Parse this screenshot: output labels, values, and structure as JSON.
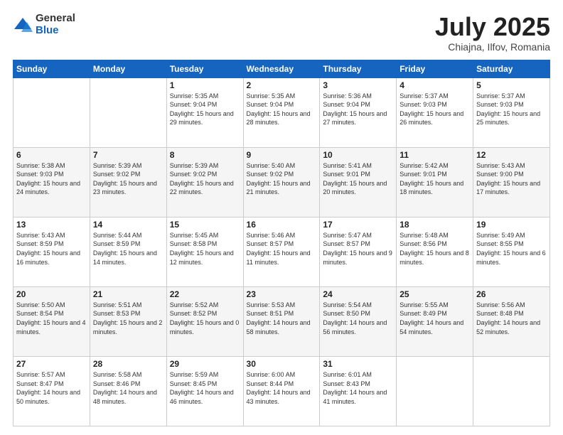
{
  "logo": {
    "general": "General",
    "blue": "Blue"
  },
  "title": "July 2025",
  "location": "Chiajna, Ilfov, Romania",
  "days_of_week": [
    "Sunday",
    "Monday",
    "Tuesday",
    "Wednesday",
    "Thursday",
    "Friday",
    "Saturday"
  ],
  "weeks": [
    [
      {
        "day": "",
        "content": ""
      },
      {
        "day": "",
        "content": ""
      },
      {
        "day": "1",
        "content": "Sunrise: 5:35 AM\nSunset: 9:04 PM\nDaylight: 15 hours and 29 minutes."
      },
      {
        "day": "2",
        "content": "Sunrise: 5:35 AM\nSunset: 9:04 PM\nDaylight: 15 hours and 28 minutes."
      },
      {
        "day": "3",
        "content": "Sunrise: 5:36 AM\nSunset: 9:04 PM\nDaylight: 15 hours and 27 minutes."
      },
      {
        "day": "4",
        "content": "Sunrise: 5:37 AM\nSunset: 9:03 PM\nDaylight: 15 hours and 26 minutes."
      },
      {
        "day": "5",
        "content": "Sunrise: 5:37 AM\nSunset: 9:03 PM\nDaylight: 15 hours and 25 minutes."
      }
    ],
    [
      {
        "day": "6",
        "content": "Sunrise: 5:38 AM\nSunset: 9:03 PM\nDaylight: 15 hours and 24 minutes."
      },
      {
        "day": "7",
        "content": "Sunrise: 5:39 AM\nSunset: 9:02 PM\nDaylight: 15 hours and 23 minutes."
      },
      {
        "day": "8",
        "content": "Sunrise: 5:39 AM\nSunset: 9:02 PM\nDaylight: 15 hours and 22 minutes."
      },
      {
        "day": "9",
        "content": "Sunrise: 5:40 AM\nSunset: 9:02 PM\nDaylight: 15 hours and 21 minutes."
      },
      {
        "day": "10",
        "content": "Sunrise: 5:41 AM\nSunset: 9:01 PM\nDaylight: 15 hours and 20 minutes."
      },
      {
        "day": "11",
        "content": "Sunrise: 5:42 AM\nSunset: 9:01 PM\nDaylight: 15 hours and 18 minutes."
      },
      {
        "day": "12",
        "content": "Sunrise: 5:43 AM\nSunset: 9:00 PM\nDaylight: 15 hours and 17 minutes."
      }
    ],
    [
      {
        "day": "13",
        "content": "Sunrise: 5:43 AM\nSunset: 8:59 PM\nDaylight: 15 hours and 16 minutes."
      },
      {
        "day": "14",
        "content": "Sunrise: 5:44 AM\nSunset: 8:59 PM\nDaylight: 15 hours and 14 minutes."
      },
      {
        "day": "15",
        "content": "Sunrise: 5:45 AM\nSunset: 8:58 PM\nDaylight: 15 hours and 12 minutes."
      },
      {
        "day": "16",
        "content": "Sunrise: 5:46 AM\nSunset: 8:57 PM\nDaylight: 15 hours and 11 minutes."
      },
      {
        "day": "17",
        "content": "Sunrise: 5:47 AM\nSunset: 8:57 PM\nDaylight: 15 hours and 9 minutes."
      },
      {
        "day": "18",
        "content": "Sunrise: 5:48 AM\nSunset: 8:56 PM\nDaylight: 15 hours and 8 minutes."
      },
      {
        "day": "19",
        "content": "Sunrise: 5:49 AM\nSunset: 8:55 PM\nDaylight: 15 hours and 6 minutes."
      }
    ],
    [
      {
        "day": "20",
        "content": "Sunrise: 5:50 AM\nSunset: 8:54 PM\nDaylight: 15 hours and 4 minutes."
      },
      {
        "day": "21",
        "content": "Sunrise: 5:51 AM\nSunset: 8:53 PM\nDaylight: 15 hours and 2 minutes."
      },
      {
        "day": "22",
        "content": "Sunrise: 5:52 AM\nSunset: 8:52 PM\nDaylight: 15 hours and 0 minutes."
      },
      {
        "day": "23",
        "content": "Sunrise: 5:53 AM\nSunset: 8:51 PM\nDaylight: 14 hours and 58 minutes."
      },
      {
        "day": "24",
        "content": "Sunrise: 5:54 AM\nSunset: 8:50 PM\nDaylight: 14 hours and 56 minutes."
      },
      {
        "day": "25",
        "content": "Sunrise: 5:55 AM\nSunset: 8:49 PM\nDaylight: 14 hours and 54 minutes."
      },
      {
        "day": "26",
        "content": "Sunrise: 5:56 AM\nSunset: 8:48 PM\nDaylight: 14 hours and 52 minutes."
      }
    ],
    [
      {
        "day": "27",
        "content": "Sunrise: 5:57 AM\nSunset: 8:47 PM\nDaylight: 14 hours and 50 minutes."
      },
      {
        "day": "28",
        "content": "Sunrise: 5:58 AM\nSunset: 8:46 PM\nDaylight: 14 hours and 48 minutes."
      },
      {
        "day": "29",
        "content": "Sunrise: 5:59 AM\nSunset: 8:45 PM\nDaylight: 14 hours and 46 minutes."
      },
      {
        "day": "30",
        "content": "Sunrise: 6:00 AM\nSunset: 8:44 PM\nDaylight: 14 hours and 43 minutes."
      },
      {
        "day": "31",
        "content": "Sunrise: 6:01 AM\nSunset: 8:43 PM\nDaylight: 14 hours and 41 minutes."
      },
      {
        "day": "",
        "content": ""
      },
      {
        "day": "",
        "content": ""
      }
    ]
  ]
}
